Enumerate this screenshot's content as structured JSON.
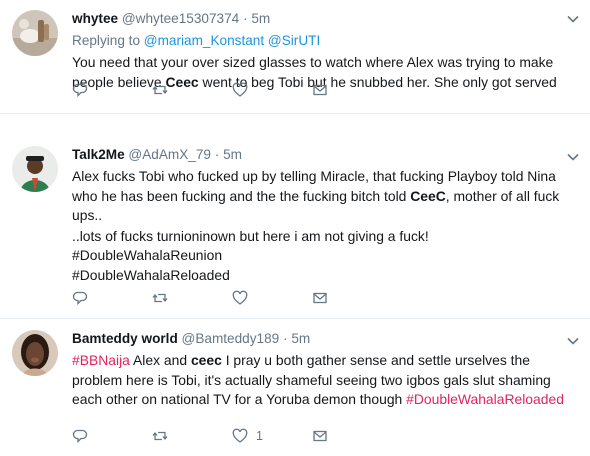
{
  "tweets": [
    {
      "name": "whytee",
      "handle": "@whytee15307374",
      "separator": "·",
      "time": "5m",
      "replying_label": "Replying to",
      "replying_to": [
        "@mariam_Konstant",
        "@SirUTI"
      ],
      "text_parts": [
        "You need that your over sized glasses to watch where Alex was trying to make people believe ",
        "Ceec",
        " went to beg Tobi but he snubbed her. She only got served"
      ],
      "like_count": ""
    },
    {
      "name": "Talk2Me",
      "handle": "@AdAmX_79",
      "separator": "·",
      "time": "5m",
      "text_parts": [
        "Alex fucks Tobi who fucked up by telling Miracle, that fucking Playboy told Nina who he has been fucking and the the fucking bitch told ",
        "CeeC",
        ", mother of all fuck ups.."
      ],
      "line2": "..lots of fucks turnioninown but here i am not giving a fuck!",
      "hashtags": [
        "#DoubleWahalaReunion",
        "#DoubleWahalaReloaded"
      ],
      "like_count": ""
    },
    {
      "name": "Bamteddy world",
      "handle": "@Bamteddy189",
      "separator": "·",
      "time": "5m",
      "hashtag_start": "#BBNaija",
      "text_parts": [
        " Alex and ",
        "ceec",
        " I pray u both gather sense and settle urselves the problem here is Tobi, it's actually shameful seeing two igbos gals slut shaming each other on national TV for a Yoruba demon though "
      ],
      "hashtag_end": "#DoubleWahalaReloaded",
      "like_count": "1"
    }
  ],
  "colors": {
    "link": "#1b95e0",
    "hashtag": "#e0245e",
    "muted": "#657786",
    "divider": "#e6ecf0"
  },
  "icons": [
    "reply-icon",
    "retweet-icon",
    "like-icon",
    "message-icon",
    "chevron-down-icon"
  ]
}
